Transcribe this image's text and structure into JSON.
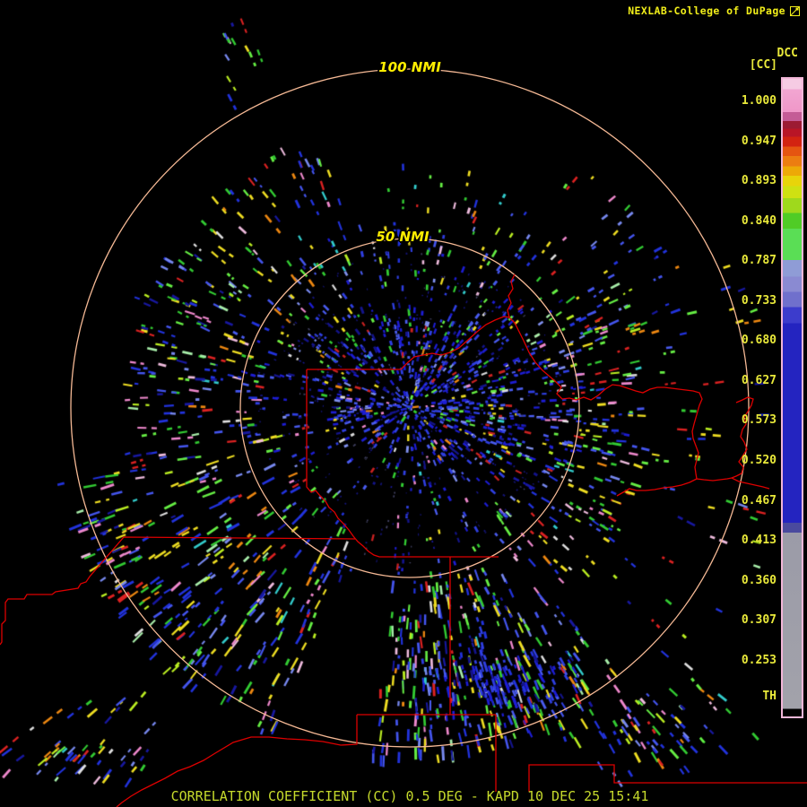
{
  "header": {
    "title": "NEXLAB-College of DuPage",
    "title_color": "#f2ef1a",
    "icon": "broken-image-icon"
  },
  "colorbar": {
    "product_label": "DCC",
    "units_label": "[CC]",
    "threshold_label": "TH",
    "tick_color": "#e9e93a",
    "border_color": "#f2b6d8",
    "ticks": [
      "1.000",
      "0.947",
      "0.893",
      "0.840",
      "0.787",
      "0.733",
      "0.680",
      "0.627",
      "0.573",
      "0.520",
      "0.467",
      "0.413",
      "0.360",
      "0.307",
      "0.253"
    ],
    "gradient_stops": [
      [
        "0%",
        "#f6cbe3"
      ],
      [
        "1.6%",
        "#f6cbe3"
      ],
      [
        "1.6%",
        "#f2a6d2"
      ],
      [
        "5.2%",
        "#ef97c8"
      ],
      [
        "5.2%",
        "#c45c96"
      ],
      [
        "6.6%",
        "#c45c96"
      ],
      [
        "6.6%",
        "#9c1b33"
      ],
      [
        "7.8%",
        "#9c1b33"
      ],
      [
        "7.8%",
        "#b91526"
      ],
      [
        "9.1%",
        "#b91526"
      ],
      [
        "9.1%",
        "#d32311"
      ],
      [
        "10.6%",
        "#d32311"
      ],
      [
        "10.6%",
        "#e55511"
      ],
      [
        "12.1%",
        "#e55511"
      ],
      [
        "12.1%",
        "#ec7d11"
      ],
      [
        "13.7%",
        "#ec7d11"
      ],
      [
        "13.7%",
        "#eda907"
      ],
      [
        "15.2%",
        "#eda907"
      ],
      [
        "15.2%",
        "#e8d40a"
      ],
      [
        "16.8%",
        "#e8d40a"
      ],
      [
        "16.8%",
        "#cfe112"
      ],
      [
        "18.7%",
        "#cfe112"
      ],
      [
        "18.7%",
        "#9fd91c"
      ],
      [
        "21%",
        "#9fd91c"
      ],
      [
        "21%",
        "#50cc26"
      ],
      [
        "23.5%",
        "#50cc26"
      ],
      [
        "23.5%",
        "#5ade55"
      ],
      [
        "28.4%",
        "#5ade55"
      ],
      [
        "28.4%",
        "#8f9cd6"
      ],
      [
        "31%",
        "#8f9cd6"
      ],
      [
        "31%",
        "#8a8ad2"
      ],
      [
        "33.4%",
        "#8a8ad2"
      ],
      [
        "33.4%",
        "#7070cc"
      ],
      [
        "35.8%",
        "#7070cc"
      ],
      [
        "35.8%",
        "#3c3ccc"
      ],
      [
        "38.3%",
        "#3c3ccc"
      ],
      [
        "38.3%",
        "#2424c0"
      ],
      [
        "69.6%",
        "#2424c0"
      ],
      [
        "69.6%",
        "#4a4a9e"
      ],
      [
        "71.2%",
        "#4a4a9e"
      ],
      [
        "71.2%",
        "#9b9ba8"
      ],
      [
        "98.8%",
        "#a2a2aa"
      ],
      [
        "98.8%",
        "#000000"
      ],
      [
        "100%",
        "#000000"
      ]
    ]
  },
  "rings": {
    "outer_label": "100 NMI",
    "inner_label": "50 NMI",
    "label_color": "#ffee00",
    "ring_color": "#f4b894"
  },
  "map": {
    "boundary_color": "#dd0000"
  },
  "status_bar": {
    "text": "CORRELATION COEFFICIENT (CC) 0.5 DEG - KAPD 10 DEC 25 15:41",
    "color": "#c6da2c"
  },
  "radar": {
    "echo_palettes": {
      "core": [
        [
          "#1d1dd4",
          26
        ],
        [
          "#2f3fe2",
          22
        ],
        [
          "#4a5cf0",
          12
        ],
        [
          "#8090ee",
          5
        ],
        [
          "#14148c",
          8
        ],
        [
          "#33cc33",
          8
        ],
        [
          "#66ee44",
          5
        ],
        [
          "#eedd22",
          6
        ],
        [
          "#cc2222",
          3
        ],
        [
          "#ee8811",
          1
        ],
        [
          "#ee88cc",
          2
        ],
        [
          "#33cccc",
          1
        ],
        [
          "#dddddd",
          1
        ]
      ],
      "outer": [
        [
          "#2233dd",
          16
        ],
        [
          "#4455ee",
          11
        ],
        [
          "#7788ee",
          6
        ],
        [
          "#33cc33",
          12
        ],
        [
          "#66ee44",
          10
        ],
        [
          "#a8eeaa",
          3
        ],
        [
          "#eedd22",
          12
        ],
        [
          "#bbee22",
          5
        ],
        [
          "#dd2222",
          6
        ],
        [
          "#ee8811",
          4
        ],
        [
          "#ee88cc",
          5
        ],
        [
          "#eebbdd",
          3
        ],
        [
          "#33cccc",
          3
        ],
        [
          "#e0e0e0",
          3
        ],
        [
          "#1818a0",
          6
        ]
      ],
      "blueblob": [
        [
          "#1d1dd4",
          38
        ],
        [
          "#2f3fe2",
          28
        ],
        [
          "#4a5cf0",
          14
        ],
        [
          "#14148c",
          9
        ],
        [
          "#33cc33",
          4
        ],
        [
          "#eedd22",
          3
        ],
        [
          "#dd2222",
          2
        ],
        [
          "#8090ee",
          2
        ]
      ],
      "dim": [
        [
          "#14147a",
          60
        ],
        [
          "#1a1a9a",
          25
        ],
        [
          "#444466",
          15
        ]
      ]
    }
  }
}
